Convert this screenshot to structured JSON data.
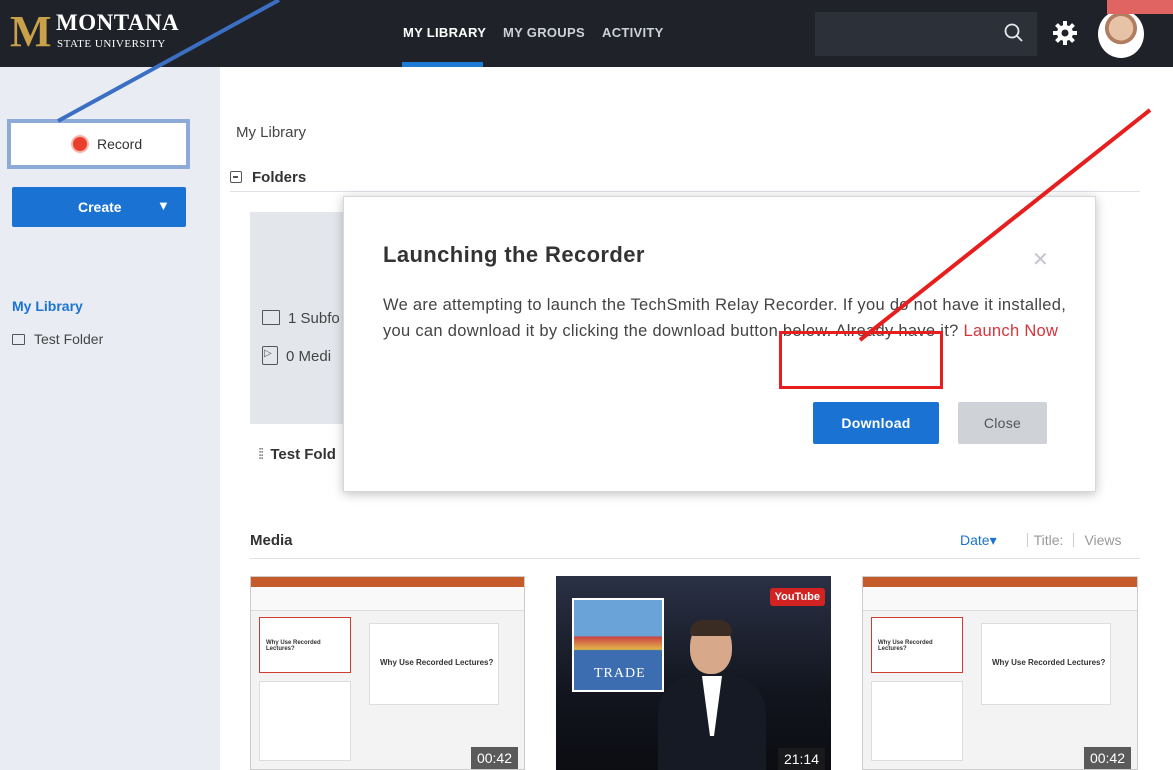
{
  "header": {
    "logo_mark": "M",
    "logo_line1": "MONTANA",
    "logo_line2": "STATE UNIVERSITY",
    "nav": [
      {
        "label": "MY LIBRARY",
        "active": true
      },
      {
        "label": "MY GROUPS",
        "active": false
      },
      {
        "label": "ACTIVITY",
        "active": false
      }
    ],
    "icons": {
      "search": "search-icon",
      "settings": "gear-icon",
      "user": "avatar"
    }
  },
  "sidebar": {
    "record_label": "Record",
    "create_label": "Create",
    "create_caret": "▼",
    "items": [
      {
        "label": "My Library",
        "active": true
      },
      {
        "label": "Test Folder",
        "active": false
      }
    ]
  },
  "main": {
    "breadcrumb": "My Library",
    "folders_heading": "Folders",
    "folder_card": {
      "subfolders": "1 Subfo",
      "media": "0 Medi",
      "title": "Test Fold"
    },
    "media_heading": "Media",
    "sort": {
      "date": "Date",
      "date_caret": "▾",
      "title": "Title:",
      "views": "Views"
    },
    "thumbnails": [
      {
        "kind": "slides",
        "slide_title": "Why Use Recorded Lectures?",
        "duration": "00:42"
      },
      {
        "kind": "video",
        "badge": "YouTube",
        "inset_text": "TRADE",
        "duration": "21:14"
      },
      {
        "kind": "slides",
        "slide_title": "Why Use Recorded Lectures?",
        "duration": "00:42"
      }
    ]
  },
  "modal": {
    "title": "Launching the Recorder",
    "body_text": "We are attempting to launch the TechSmith Relay Recorder. If you do not have it installed, you can download it by clicking the download button below. Already have it? ",
    "launch_link": "Launch Now",
    "download_label": "Download",
    "close_label": "Close",
    "close_x": "✕"
  },
  "colors": {
    "nav_bg": "#1f2228",
    "accent_blue": "#1a73d3",
    "sidebar_bg": "#e9edf3",
    "link_red": "#d8343b",
    "annotation_red": "#e61e1e",
    "annotation_blue": "#3a6fc4"
  }
}
